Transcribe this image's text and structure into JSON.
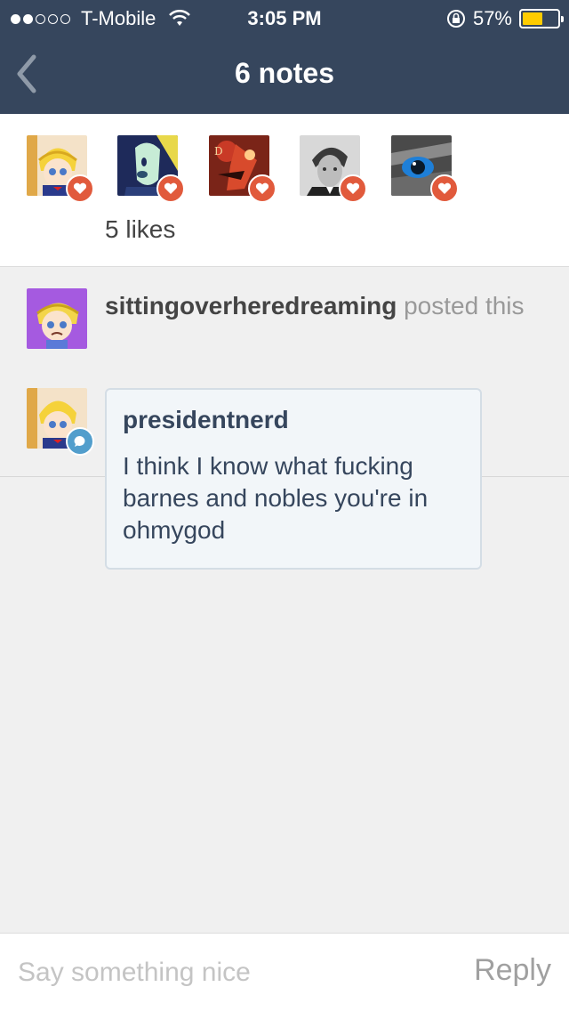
{
  "status_bar": {
    "carrier": "T-Mobile",
    "time": "3:05 PM",
    "battery_percent": "57%",
    "battery_level": 0.57,
    "signal_bars_filled": 2,
    "signal_bars_total": 5
  },
  "nav": {
    "title": "6 notes",
    "back_icon": "chevron-left-icon"
  },
  "likes": {
    "count_label": "5 likes",
    "avatars": [
      {
        "name": "blond-anime-avatar",
        "badge": "heart-icon"
      },
      {
        "name": "gem-character-avatar",
        "badge": "heart-icon"
      },
      {
        "name": "red-character-avatar",
        "badge": "heart-icon"
      },
      {
        "name": "vintage-portrait-avatar",
        "badge": "heart-icon"
      },
      {
        "name": "blue-eye-avatar",
        "badge": "heart-icon"
      }
    ]
  },
  "notes": {
    "post": {
      "username": "sittingoverheredreaming",
      "action": "posted this"
    },
    "reply": {
      "username": "presidentnerd",
      "text": "I think I know what fucking barnes and nobles you're in ohmygod"
    }
  },
  "footer": {
    "placeholder": "Say something nice",
    "reply_label": "Reply"
  },
  "colors": {
    "header_bg": "#36465d",
    "heart_badge": "#e15a3c",
    "chat_badge": "#529ecc",
    "bubble_bg": "#f2f6f9"
  }
}
